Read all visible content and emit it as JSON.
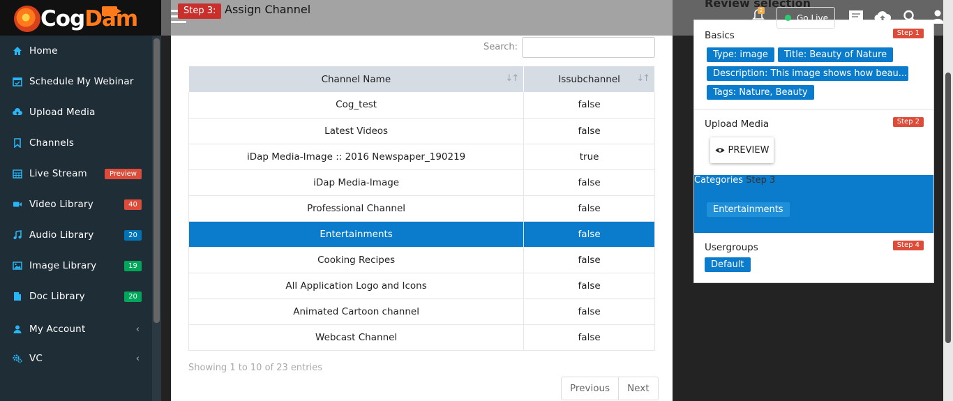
{
  "brand": {
    "logo_part1": "Cog",
    "logo_part2": "Dam"
  },
  "sidebar": {
    "items": [
      {
        "label": "Home",
        "icon": "home-icon"
      },
      {
        "label": "Schedule My Webinar",
        "icon": "calendar-icon"
      },
      {
        "label": "Upload Media",
        "icon": "cloud-upload-icon"
      },
      {
        "label": "Channels",
        "icon": "bookmark-icon"
      },
      {
        "label": "Live Stream",
        "icon": "calendar-grid-icon",
        "badge": "Preview"
      },
      {
        "label": "Video Library",
        "icon": "video-camera-icon",
        "badge": "40"
      },
      {
        "label": "Audio Library",
        "icon": "music-icon",
        "badge": "20"
      },
      {
        "label": "Image Library",
        "icon": "image-icon",
        "badge": "19"
      },
      {
        "label": "Doc Library",
        "icon": "file-icon",
        "badge": "20"
      },
      {
        "label": "My Account",
        "icon": "user-icon",
        "chevron": "‹"
      },
      {
        "label": "VC",
        "icon": "cogs-icon",
        "chevron": "‹"
      }
    ]
  },
  "header": {
    "step_tag": "Step 3:",
    "title": "Assign Channel",
    "notification_count": "2",
    "go_live_label": "Go Live"
  },
  "table": {
    "search_label": "Search:",
    "search_value": "",
    "columns": [
      "Channel Name",
      "Issubchannel"
    ],
    "rows": [
      {
        "name": "Cog_test",
        "sub": "false"
      },
      {
        "name": "Latest Videos",
        "sub": "false"
      },
      {
        "name": "iDap Media-Image :: 2016 Newspaper_190219",
        "sub": "true"
      },
      {
        "name": "iDap Media-Image",
        "sub": "false"
      },
      {
        "name": "Professional Channel",
        "sub": "false"
      },
      {
        "name": "Entertainments",
        "sub": "false",
        "selected": true
      },
      {
        "name": "Cooking Recipes",
        "sub": "false"
      },
      {
        "name": "All Application Logo and Icons",
        "sub": "false"
      },
      {
        "name": "Animated Cartoon channel",
        "sub": "false"
      },
      {
        "name": "Webcast Channel",
        "sub": "false"
      }
    ],
    "info": "Showing 1 to 10 of 23 entries",
    "previous_label": "Previous",
    "next_label": "Next"
  },
  "review": {
    "title": "Review selection",
    "basics": {
      "label": "Basics",
      "step": "Step 1",
      "chips": [
        "Type: image",
        "Title: Beauty of Nature",
        "Description: This image shows how beau...",
        "Tags: Nature, Beauty"
      ]
    },
    "upload": {
      "label": "Upload Media",
      "step": "Step 2",
      "preview_label": "PREVIEW"
    },
    "categories": {
      "label": "Categories",
      "step": "Step 3",
      "chips": [
        "Entertainments"
      ]
    },
    "usergroups": {
      "label": "Usergroups",
      "step": "Step 4",
      "chips": [
        "Default"
      ]
    }
  },
  "colors": {
    "sidebar_bg": "#1f2d36",
    "accent_blue": "#0a7ccb",
    "step_red": "#dd4b39",
    "badge_green": "#00a65a",
    "badge_blue": "#0073b7"
  }
}
